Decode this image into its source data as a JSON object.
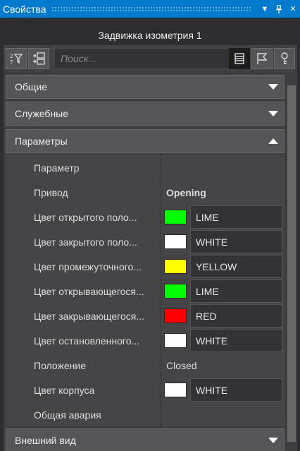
{
  "window": {
    "title": "Свойства"
  },
  "header": {
    "title": "Задвижка изометрия 1"
  },
  "toolbar": {
    "search_placeholder": "Поиск..."
  },
  "sections": {
    "general": "Общие",
    "service": "Служебные",
    "parameters": "Параметры",
    "appearance": "Внешний вид"
  },
  "properties": [
    {
      "name": "Параметр",
      "value": ""
    },
    {
      "name": "Привод",
      "value": "Opening"
    },
    {
      "name": "Цвет открытого поло...",
      "value": "LIME",
      "swatch": "#00ff00"
    },
    {
      "name": "Цвет закрытого поло...",
      "value": "WHITE",
      "swatch": "#ffffff"
    },
    {
      "name": "Цвет промежуточного...",
      "value": "YELLOW",
      "swatch": "#ffff00"
    },
    {
      "name": "Цвет открывающегося...",
      "value": "LIME",
      "swatch": "#00ff00"
    },
    {
      "name": "Цвет закрывающегося...",
      "value": "RED",
      "swatch": "#ff0000"
    },
    {
      "name": "Цвет остановленного...",
      "value": "WHITE",
      "swatch": "#ffffff"
    },
    {
      "name": "Положение",
      "value": "Closed"
    },
    {
      "name": "Цвет корпуса",
      "value": "WHITE",
      "swatch": "#ffffff"
    },
    {
      "name": "Общая авария",
      "value": ""
    }
  ],
  "colors": {
    "accent": "#007acc",
    "background": "#3e3e40"
  }
}
